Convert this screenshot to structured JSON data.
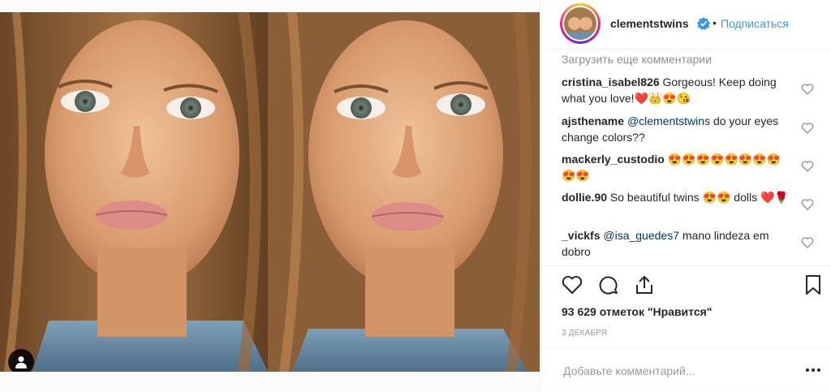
{
  "post": {
    "username": "clementstwins",
    "follow_label": "Подписаться",
    "separator": "•"
  },
  "comments": {
    "load_more": "Загрузить еще комментарии",
    "items": [
      {
        "user": "cristina_isabel826",
        "text": " Gorgeous! Keep doing what you love!❤️👑😍😘"
      },
      {
        "user": "ajsthename",
        "mention": "@clementstwins",
        "text": " do your eyes change colors??"
      },
      {
        "user": "mackerly_custodio",
        "text": " 😍😍😍😍😍😍😍😍😍😍"
      },
      {
        "user": "dollie.90",
        "text": " So beautiful twins 😍😍 dolls ❤️🌹"
      },
      {
        "user": "_vickfs",
        "mention": "@isa_guedes7",
        "text": " mano lindeza em dobro"
      }
    ]
  },
  "likes": {
    "count": "93 629",
    "label": " отметок \"Нравится\""
  },
  "date": "3 ДЕКАБРЯ",
  "comment_input": {
    "placeholder": "Добавьте комментарий...",
    "value": ""
  },
  "icons": {
    "like": "heart-icon",
    "comment": "comment-icon",
    "share": "share-icon",
    "save": "bookmark-icon",
    "user_tag": "user-icon",
    "more": "ellipsis-icon",
    "verified": "verified-badge-icon"
  },
  "colors": {
    "link": "#3897f0",
    "verified": "#3897f0",
    "text": "#262626",
    "muted": "#8e8e8e"
  }
}
